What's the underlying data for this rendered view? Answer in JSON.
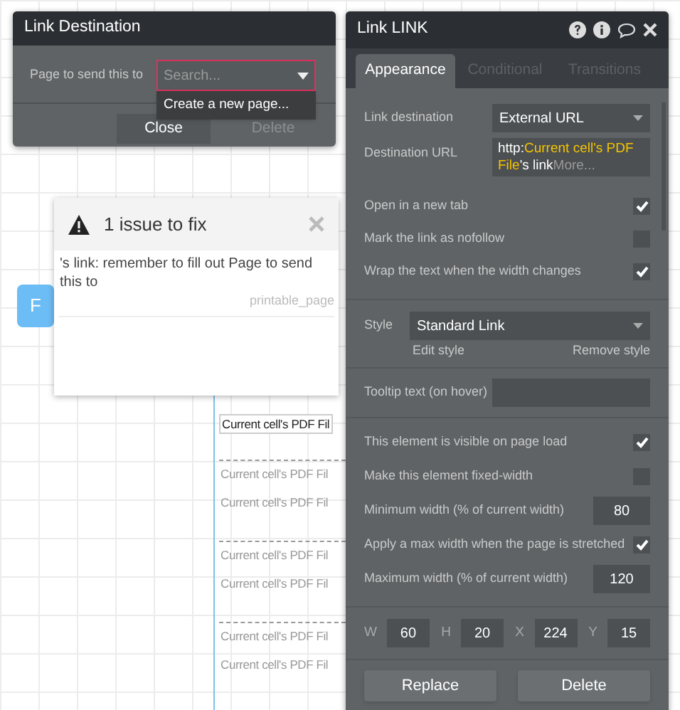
{
  "canvas": {
    "button": {
      "label": "F"
    },
    "list_items": [
      {
        "text": "Current cell's PDF Fil",
        "selected": true
      },
      {
        "text": "Current cell's PDF Fil",
        "selected": false
      },
      {
        "text": "Current cell's PDF Fil",
        "selected": false
      },
      {
        "text": "Current cell's PDF Fil",
        "selected": false
      },
      {
        "text": "Current cell's PDF Fil",
        "selected": false
      },
      {
        "text": "Current cell's PDF Fil",
        "selected": false
      },
      {
        "text": "Current cell's PDF Fil",
        "selected": false
      }
    ]
  },
  "link_destination": {
    "title": "Link Destination",
    "label": "Page to send this to",
    "search": {
      "placeholder": "Search..."
    },
    "menu": [
      "Create a new page..."
    ],
    "buttons": [
      {
        "label": "Close",
        "disabled": false
      },
      {
        "label": "Delete",
        "disabled": true
      }
    ]
  },
  "issues": {
    "title": "1 issue to fix",
    "message": "'s link: remember to fill out Page to send this to",
    "source": "printable_page"
  },
  "inspector": {
    "title": "Link LINK",
    "tabs": [
      {
        "label": "Appearance",
        "selected": true
      },
      {
        "label": "Conditional",
        "selected": false
      },
      {
        "label": "Transitions",
        "selected": false
      }
    ],
    "link_destination": {
      "label": "Link destination",
      "value": "External URL"
    },
    "destination_url": {
      "label": "Destination URL",
      "parts": [
        {
          "text": "http:",
          "kind": "plain"
        },
        {
          "text": "Current cell's PDF File",
          "kind": "dynamic"
        },
        {
          "text": "'s link",
          "kind": "plain"
        },
        {
          "text": "More...",
          "kind": "more"
        }
      ]
    },
    "options_1": [
      {
        "label": "Open in a new tab",
        "checked": true
      },
      {
        "label": "Mark the link as nofollow",
        "checked": false
      },
      {
        "label": "Wrap the text when the width changes",
        "checked": true
      }
    ],
    "style": {
      "label": "Style",
      "value": "Standard Link",
      "edit": "Edit style",
      "remove": "Remove style"
    },
    "tooltip": {
      "label": "Tooltip text (on hover)"
    },
    "options_2": [
      {
        "kind": "check",
        "label": "This element is visible on page load",
        "checked": true
      },
      {
        "kind": "check",
        "label": "Make this element fixed-width",
        "checked": false
      },
      {
        "kind": "number",
        "label": "Minimum width (% of current width)",
        "value": "80"
      },
      {
        "kind": "check",
        "label": "Apply a max width when the page is stretched",
        "checked": true
      },
      {
        "kind": "number",
        "label": "Maximum width (% of current width)",
        "value": "120"
      }
    ],
    "geometry": [
      {
        "label": "W",
        "value": "60"
      },
      {
        "label": "H",
        "value": "20"
      },
      {
        "label": "X",
        "value": "224"
      },
      {
        "label": "Y",
        "value": "15"
      }
    ],
    "buttons": [
      "Replace",
      "Delete"
    ]
  }
}
